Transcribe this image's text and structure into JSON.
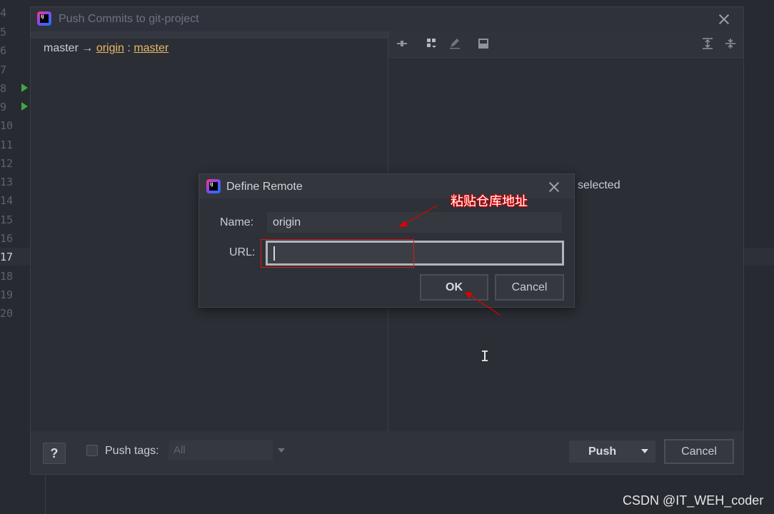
{
  "editor": {
    "line_numbers": [
      "4",
      "5",
      "6",
      "7",
      "8",
      "9",
      "10",
      "11",
      "12",
      "13",
      "14",
      "15",
      "16",
      "17",
      "18",
      "19",
      "20"
    ],
    "current_line": "17"
  },
  "push_window": {
    "title": "Push Commits to git-project",
    "branch": {
      "local": "master",
      "arrow": "→",
      "remote": "origin",
      "separator": ":",
      "remote_branch": "master"
    },
    "right_panel_text": "selected",
    "toolbar_icons": [
      "diff-icon",
      "group-by-icon",
      "edit-icon",
      "preview-icon",
      "expand-all-icon",
      "collapse-all-icon"
    ],
    "bottom": {
      "help_label": "?",
      "push_tags_label": "Push tags:",
      "tags_value": "All",
      "push_label": "Push",
      "cancel_label": "Cancel"
    }
  },
  "dialog": {
    "title": "Define Remote",
    "name_label": "Name:",
    "name_value": "origin",
    "url_label": "URL:",
    "url_value": "",
    "ok_label": "OK",
    "cancel_label": "Cancel"
  },
  "annotation": {
    "text": "粘贴仓库地址",
    "color": "#e00000"
  },
  "watermark": "CSDN @IT_WEH_coder"
}
